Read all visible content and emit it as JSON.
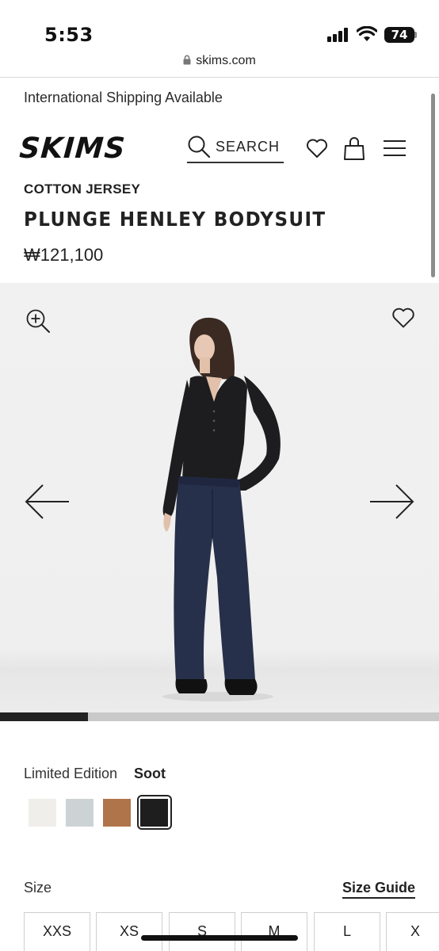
{
  "status_bar": {
    "time": "5:53",
    "battery": "74"
  },
  "browser": {
    "url": "skims.com"
  },
  "promo": {
    "text": "International Shipping Available"
  },
  "header": {
    "logo_text": "SKIMS",
    "search_label": "SEARCH"
  },
  "product": {
    "collection": "COTTON JERSEY",
    "title": "PLUNGE HENLEY BODYSUIT",
    "price": "₩121,100"
  },
  "gallery": {
    "progress": 0.2
  },
  "color": {
    "label": "Limited Edition",
    "value": "Soot",
    "swatches": [
      "#f0eeea",
      "#cdd3d5",
      "#b0744a",
      "#1e1e1e"
    ],
    "selected_index": 3
  },
  "size": {
    "label": "Size",
    "guide_label": "Size Guide",
    "options": [
      "XXS",
      "XS",
      "S",
      "M",
      "L",
      "X"
    ]
  }
}
